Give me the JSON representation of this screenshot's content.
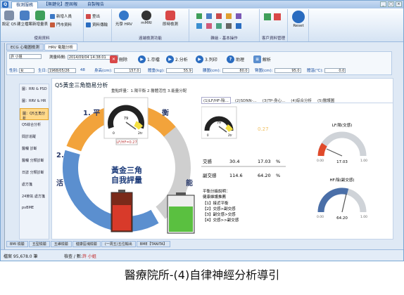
{
  "titlebar": {
    "logo": "Q",
    "tabs": [
      "檢測服務",
      "【無鍵化】歷屆報",
      "自製報告"
    ]
  },
  "ribbon": {
    "buttons": {
      "settings": "設定 Q5",
      "create_profile": "建立檔案",
      "add_profile": "新增量表",
      "new_patient": "新增人員",
      "outpatient": "門市資料",
      "logout": "登出",
      "data_transfer": "資料傳輸",
      "photo_hrv": "光學 HRV",
      "mmri": "mMRI",
      "measure": "即時檢測",
      "reset": "Reset"
    },
    "groups": {
      "user": "使用資料",
      "remote": "遠端檢測功能",
      "basic": "雜繪 - 基本操作",
      "customer": "客戶資料管理"
    }
  },
  "doctabs": [
    "ECG 心電圖檢測",
    "HRV 電腦分析"
  ],
  "patient": {
    "name": "許 小姐",
    "measure_time_label": "測量時間:",
    "measure_time": "2014/09/04 14:38:01",
    "gender_label": "性別:",
    "gender": "女",
    "birth_label": "生日:",
    "birth": "1968/05/26",
    "age": "48",
    "height_label": "身高(cm):",
    "height": "157.0",
    "weight_label": "體重(kg):",
    "weight": "55.9",
    "waist_label": "腰圍(cm):",
    "waist": "80.0",
    "hip_label": "臀圍(cm):",
    "hip": "95.0",
    "temp_label": "體溫(℃):",
    "temp": "0.0"
  },
  "toolbar": {
    "delete": "刪除",
    "save": "1.存檔",
    "analyze": "2.分析",
    "print": "3.列印",
    "help": "助理",
    "parse": "解析"
  },
  "sidenav": [
    "圖：RRI & PSD",
    "圖：RRV & HR",
    "圖：Q5五角分析",
    "Q5綜合分析",
    "間診追蹤",
    "醫囑 診斷",
    "醫囑 分類診斷",
    "日誌 分類診斷",
    "處方箋",
    "24節氣 處方箋",
    "pvBME"
  ],
  "content": {
    "title": "Q5黃金三角簡易分析",
    "score_text": "重點評量：1.陽平衡 2.醫體活性 3.能量分配",
    "triangle": {
      "label1": "1. 平",
      "label2": "衡",
      "label3": "2.",
      "label4": "活",
      "label5": "能",
      "center1": "黃金三角",
      "center2": "自我評量"
    },
    "gauge1": {
      "value": "79",
      "min": "0",
      "max": "2tr"
    },
    "lf_hf": "LF/HF=0.27",
    "right_tabs": [
      "(1)LF/HF-陰...",
      "(2)SDNN-...",
      "(3)TP-身心...",
      "(4)綜合分析",
      "(5)醫護圖"
    ],
    "gauge2": {
      "value": "79",
      "min": "0",
      "max": "2tr"
    },
    "red_value": "0.27",
    "table": [
      {
        "label": "交感",
        "v1": "30.4",
        "v2": "17.03",
        "u": "%"
      },
      {
        "label": "副交感",
        "v1": "114.6",
        "v2": "64.20",
        "u": "%"
      }
    ],
    "legend_title": "平衡分級說明：",
    "legend_sub": "健康維護推薦",
    "legend": [
      "【1】接近平衡",
      "【2】交感>副交感",
      "【3】副交感>交感",
      "【4】交感>>副交感"
    ],
    "lf_gauge": {
      "title": "LF:陽(交感)",
      "value": "17.03",
      "min": "0.00",
      "max": "1.00"
    },
    "hf_gauge": {
      "title": "HF:陰(副交感)",
      "value": "64.20",
      "min": "0.00",
      "max": "1.00"
    }
  },
  "bottom_tabs": [
    "BMI 檢驗",
    "五型檢驗",
    "五維檢驗",
    "健康區塊檢驗",
    "(一周五)五位輸出",
    "BME【TANITA】"
  ],
  "status": {
    "record": "檔案 95,678.0 筆",
    "user_label": "檢查 / 數:",
    "user": "許 小姐"
  },
  "caption": "醫療院所-(4)自律神經分析導引",
  "colors": {
    "accent": "#2a6cc0",
    "arc_orange": "#f1a23a",
    "arc_blue": "#5b8fcf",
    "needle_yellow": "#f5e042"
  }
}
